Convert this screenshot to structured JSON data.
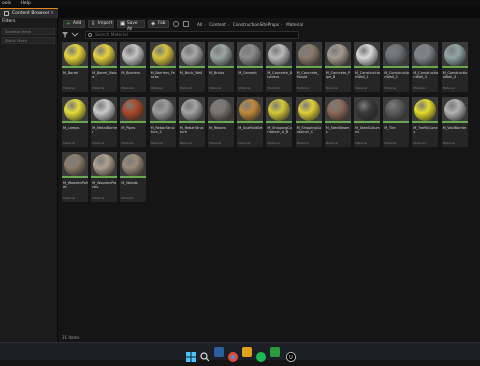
{
  "menubar": {
    "items": [
      "ools",
      "Help"
    ]
  },
  "tab": {
    "label": "Content Browser"
  },
  "left_panel": {
    "header": "Filters",
    "items": [
      "Skeletal Mesh",
      "Static Mesh"
    ]
  },
  "toolbar": {
    "add_label": "Add",
    "import_label": "Import",
    "save_all_label": "Save All",
    "fab_label": "Fab"
  },
  "breadcrumb": [
    "All",
    "Content",
    "ConstructionSiteProps",
    "Material"
  ],
  "search": {
    "placeholder": "Search Material"
  },
  "assets": [
    {
      "name": "M_Barrel",
      "type": "Material",
      "color": "#e8d63a"
    },
    {
      "name": "M_Barrel_Noise",
      "type": "Material",
      "color": "#e4d23c"
    },
    {
      "name": "M_Barriers",
      "type": "Material",
      "color": "#c4c4c4"
    },
    {
      "name": "M_Barriers_Fences",
      "type": "Material",
      "color": "#d7c33e"
    },
    {
      "name": "M_Brick_Wall",
      "type": "Material",
      "color": "#a8a8a8"
    },
    {
      "name": "M_Bricks",
      "type": "Material",
      "color": "#9aa7a3"
    },
    {
      "name": "M_Cement",
      "type": "Material",
      "color": "#8c8c8c"
    },
    {
      "name": "M_Concrete_Dividers",
      "type": "Material",
      "color": "#b9b9b9"
    },
    {
      "name": "M_Concrete_Mould",
      "type": "Material",
      "color": "#8a7a6a"
    },
    {
      "name": "M_Concrete_Pipe_B",
      "type": "Material",
      "color": "#a49b90"
    },
    {
      "name": "M_ConstructionWall_1",
      "type": "Material",
      "color": "#d8d8d8"
    },
    {
      "name": "M_ConstructionWall_2",
      "type": "Material",
      "color": "#6e7276"
    },
    {
      "name": "M_ConstructionWall_3",
      "type": "Material",
      "color": "#808589"
    },
    {
      "name": "M_ConstructionWall_4",
      "type": "Material",
      "color": "#8fa6a4"
    },
    {
      "name": "M_Lamps",
      "type": "Material",
      "color": "#e3dd3a"
    },
    {
      "name": "M_MetalBarrier",
      "type": "Material",
      "color": "#c9c9c9"
    },
    {
      "name": "M_Pipes",
      "type": "Material",
      "color": "#a84a2a"
    },
    {
      "name": "M_RebarStructure_2",
      "type": "Material",
      "color": "#9c9c9c"
    },
    {
      "name": "M_RebarStructure",
      "type": "Material",
      "color": "#a3a3a3"
    },
    {
      "name": "M_Rebars",
      "type": "Material",
      "color": "#7a7570"
    },
    {
      "name": "M_ScaffoldSet",
      "type": "Material",
      "color": "#c08a3a"
    },
    {
      "name": "M_ShippingContainer_A_B",
      "type": "Material",
      "color": "#d6c93a"
    },
    {
      "name": "M_ShippingContainer_C",
      "type": "Material",
      "color": "#e0cf3a"
    },
    {
      "name": "M_SteelBeams",
      "type": "Material",
      "color": "#8c6a5a"
    },
    {
      "name": "M_SteelColumns",
      "type": "Material",
      "color": "#3a3a3a"
    },
    {
      "name": "M_Tire",
      "type": "Material",
      "color": "#5a5a5a"
    },
    {
      "name": "M_TrafficCones",
      "type": "Material",
      "color": "#e6dc2a"
    },
    {
      "name": "M_WallBarrier",
      "type": "Material",
      "color": "#b2b2b2"
    },
    {
      "name": "M_WoodenPallet",
      "type": "Material",
      "color": "#8c7c6a"
    },
    {
      "name": "M_WoodenPlanks",
      "type": "Material",
      "color": "#b0a090"
    },
    {
      "name": "M_Woods",
      "type": "Material",
      "color": "#9a8c78"
    }
  ],
  "status": {
    "count": "31 items"
  },
  "accent_color": "#e08a1e",
  "material_underline_color": "#6aa84f"
}
